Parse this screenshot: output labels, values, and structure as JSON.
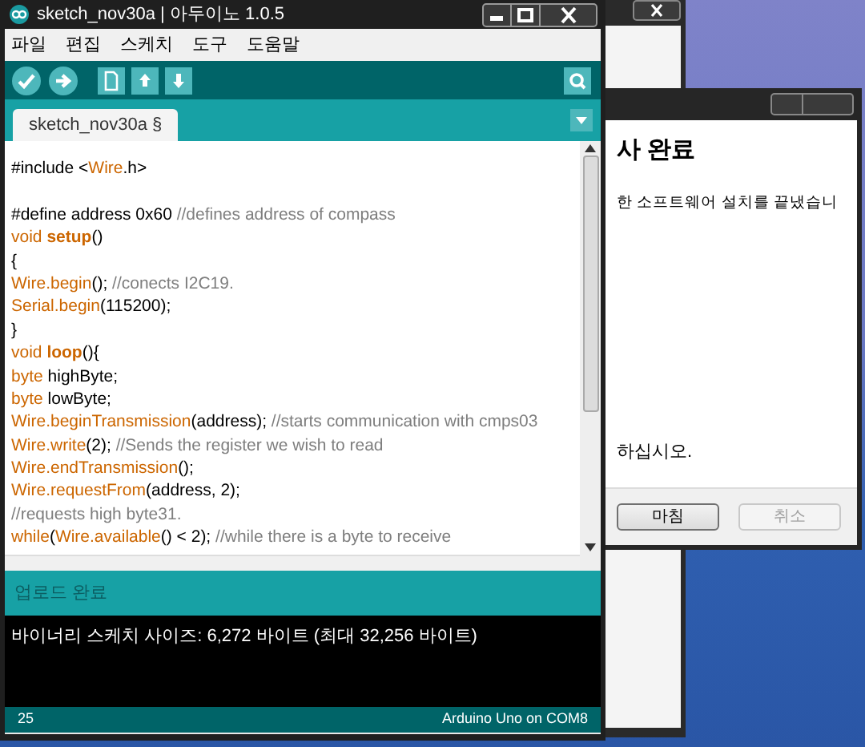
{
  "arduino_window": {
    "title": "sketch_nov30a | 아두이노 1.0.5",
    "menu": [
      "파일",
      "편집",
      "스케치",
      "도구",
      "도움말"
    ],
    "tabs": [
      {
        "label": "sketch_nov30a §",
        "selected": true
      }
    ],
    "code_lines": [
      {
        "kind": "code",
        "tokens": [
          {
            "kind": "plain",
            "text": "#include <"
          },
          {
            "kind": "keyword",
            "text": "Wire"
          },
          {
            "kind": "plain",
            "text": ".h>"
          }
        ]
      },
      {
        "kind": "blank"
      },
      {
        "kind": "code",
        "tokens": [
          {
            "kind": "plain",
            "text": "#define address 0x60 "
          },
          {
            "kind": "comment",
            "text": "//defines address of compass"
          }
        ]
      },
      {
        "kind": "code",
        "tokens": [
          {
            "kind": "keyword",
            "text": "void "
          },
          {
            "kind": "bold",
            "text": "setup"
          },
          {
            "kind": "plain",
            "text": "()"
          }
        ]
      },
      {
        "kind": "code",
        "tokens": [
          {
            "kind": "plain",
            "text": "{"
          }
        ]
      },
      {
        "kind": "code",
        "tokens": [
          {
            "kind": "keyword",
            "text": "Wire.begin"
          },
          {
            "kind": "plain",
            "text": "(); "
          },
          {
            "kind": "comment",
            "text": "//conects I2C19."
          }
        ]
      },
      {
        "kind": "code",
        "tokens": [
          {
            "kind": "keyword",
            "text": "Serial.begin"
          },
          {
            "kind": "plain",
            "text": "(115200);"
          }
        ]
      },
      {
        "kind": "code",
        "tokens": [
          {
            "kind": "plain",
            "text": "}"
          }
        ]
      },
      {
        "kind": "code",
        "tokens": [
          {
            "kind": "keyword",
            "text": "void "
          },
          {
            "kind": "bold",
            "text": "loop"
          },
          {
            "kind": "plain",
            "text": "(){"
          }
        ]
      },
      {
        "kind": "code",
        "tokens": [
          {
            "kind": "keyword",
            "text": "byte"
          },
          {
            "kind": "plain",
            "text": " highByte;"
          }
        ]
      },
      {
        "kind": "code",
        "tokens": [
          {
            "kind": "keyword",
            "text": "byte"
          },
          {
            "kind": "plain",
            "text": " lowByte;"
          }
        ]
      },
      {
        "kind": "code",
        "tokens": [
          {
            "kind": "keyword",
            "text": "Wire.beginTransmission"
          },
          {
            "kind": "plain",
            "text": "(address); "
          },
          {
            "kind": "comment",
            "text": "//starts communication with cmps03"
          }
        ]
      },
      {
        "kind": "code",
        "tokens": [
          {
            "kind": "keyword",
            "text": "Wire.write"
          },
          {
            "kind": "plain",
            "text": "(2); "
          },
          {
            "kind": "comment",
            "text": "//Sends the register we wish to read"
          }
        ]
      },
      {
        "kind": "code",
        "tokens": [
          {
            "kind": "keyword",
            "text": "Wire.endTransmission"
          },
          {
            "kind": "plain",
            "text": "();"
          }
        ]
      },
      {
        "kind": "code",
        "tokens": [
          {
            "kind": "keyword",
            "text": "Wire.requestFrom"
          },
          {
            "kind": "plain",
            "text": "(address, 2);"
          }
        ]
      },
      {
        "kind": "code",
        "tokens": [
          {
            "kind": "comment",
            "text": "//requests high byte31."
          }
        ]
      },
      {
        "kind": "code",
        "tokens": [
          {
            "kind": "keyword",
            "text": "while"
          },
          {
            "kind": "plain",
            "text": "("
          },
          {
            "kind": "keyword",
            "text": "Wire.available"
          },
          {
            "kind": "plain",
            "text": "() < 2); "
          },
          {
            "kind": "comment",
            "text": "//while there is a byte to receive"
          }
        ]
      }
    ],
    "status_message": "업로드 완료",
    "console_lines": [
      "바이너리 스케치 사이즈: 6,272 바이트 (최대 32,256 바이트)"
    ],
    "footer": {
      "line": "25",
      "board": "Arduino Uno on COM8"
    }
  },
  "installer_dialog": {
    "heading": "사 완료",
    "message": "한 소프트웨어 설치를 끝냈습니",
    "instruction": "하십시오.",
    "buttons": [
      {
        "label": "마침",
        "disabled": false
      },
      {
        "label": "취소",
        "disabled": true
      }
    ]
  }
}
